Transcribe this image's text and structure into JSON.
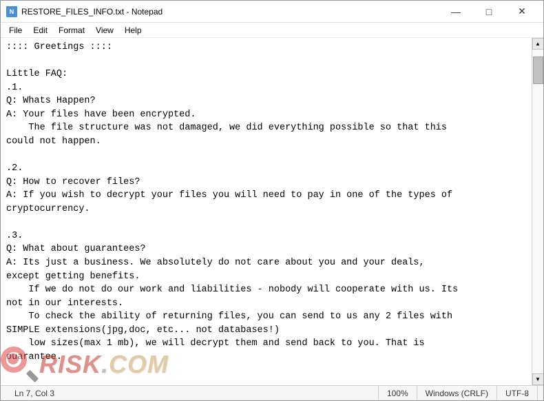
{
  "window": {
    "title": "RESTORE_FILES_INFO.txt - Notepad",
    "icon_label": "N"
  },
  "title_bar": {
    "minimize_label": "—",
    "maximize_label": "□",
    "close_label": "✕"
  },
  "menu": {
    "items": [
      "File",
      "Edit",
      "Format",
      "View",
      "Help"
    ]
  },
  "content": {
    "text": ":::: Greetings ::::\n\nLittle FAQ:\n.1.\nQ: Whats Happen?\nA: Your files have been encrypted.\n    The file structure was not damaged, we did everything possible so that this\ncould not happen.\n\n.2.\nQ: How to recover files?\nA: If you wish to decrypt your files you will need to pay in one of the types of\ncryptocurrency.\n\n.3.\nQ: What about guarantees?\nA: Its just a business. We absolutely do not care about you and your deals,\nexcept getting benefits.\n    If we do not do our work and liabilities - nobody will cooperate with us. Its\nnot in our interests.\n    To check the ability of returning files, you can send to us any 2 files with\nSIMPLE extensions(jpg,doc, etc... not databases!)\n    low sizes(max 1 mb), we will decrypt them and send back to you. That is\nouarantee."
  },
  "status_bar": {
    "position": "Ln 7, Col 3",
    "zoom": "100%",
    "line_endings": "Windows (CRLF)",
    "encoding": "UTF-8"
  },
  "watermark": {
    "text": "RISK.COM"
  }
}
